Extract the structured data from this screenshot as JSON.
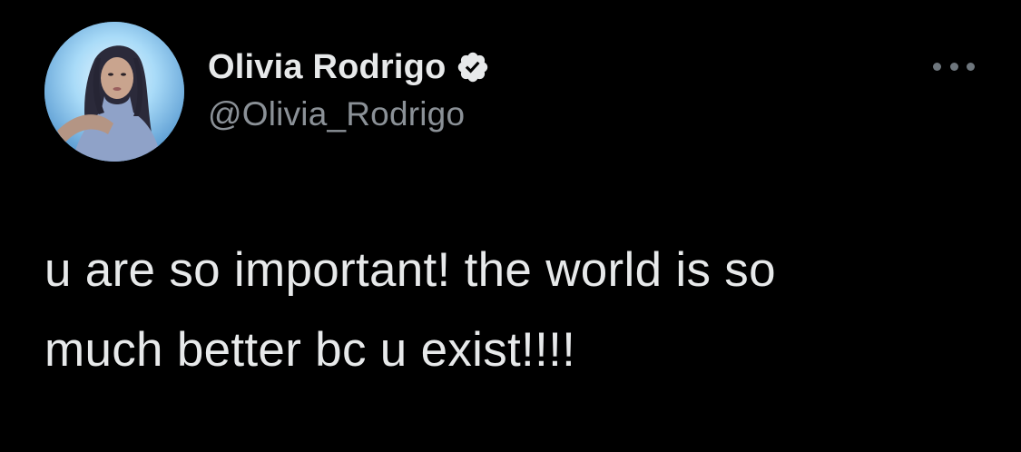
{
  "tweet": {
    "author": {
      "display_name": "Olivia Rodrigo",
      "handle": "@Olivia_Rodrigo",
      "verified": true,
      "avatar_icon": "profile-photo"
    },
    "text": "u are so important! the world is so\nmuch better bc u exist!!!!",
    "more_icon": "more-options-icon"
  },
  "colors": {
    "background": "#000000",
    "name": "#e7e9ea",
    "handle": "#8b9197",
    "text": "#e7e9ea",
    "verified_badge": "#e7e9ea"
  }
}
